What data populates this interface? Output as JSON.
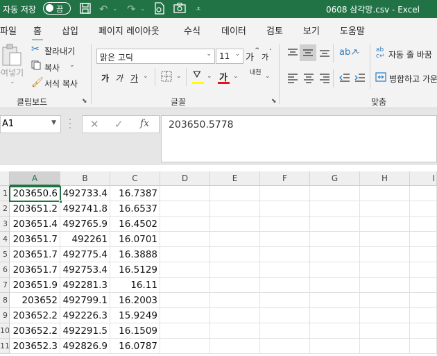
{
  "titlebar": {
    "autosave_label": "자동 저장",
    "toggle_label": "끔",
    "doc_title": "0608 삼각망.csv  -  Excel"
  },
  "tabs": [
    "파일",
    "홈",
    "삽입",
    "페이지 레이아웃",
    "수식",
    "데이터",
    "검토",
    "보기",
    "도움말"
  ],
  "active_tab": "홈",
  "clipboard": {
    "paste_label": "붙여넣기",
    "cut_label": "잘라내기",
    "copy_label": "복사",
    "format_painter_label": "서식 복사",
    "group_label": "클립보드"
  },
  "font": {
    "name": "맑은 고딕",
    "size": "11",
    "grow": "가",
    "shrink": "가",
    "bold": "가",
    "italic": "가",
    "underline": "가",
    "font_color": "가",
    "phonetic": "내천",
    "group_label": "글꼴",
    "fill_color": "#ffff00",
    "text_color": "#e81123"
  },
  "alignment": {
    "wrap_text_label": "자동 줄 바꿈",
    "merge_label": "병합하고 가운",
    "group_label": "맞춤"
  },
  "formula_bar": {
    "name_box": "A1",
    "cancel": "✕",
    "enter": "✓",
    "fx": "fx",
    "value": "203650.5778"
  },
  "accent_color": "#217346",
  "grid": {
    "columns": [
      "A",
      "B",
      "C",
      "D",
      "E",
      "F",
      "G",
      "H",
      "I"
    ],
    "row_headers": [
      "1",
      "2",
      "3",
      "4",
      "5",
      "6",
      "7",
      "8",
      "9",
      "10",
      "11"
    ],
    "rows": [
      [
        "203650.6",
        "492733.4",
        "16.7387"
      ],
      [
        "203651.2",
        "492741.8",
        "16.6537"
      ],
      [
        "203651.4",
        "492765.9",
        "16.4502"
      ],
      [
        "203651.7",
        "492261",
        "16.0701"
      ],
      [
        "203651.7",
        "492775.4",
        "16.3888"
      ],
      [
        "203651.7",
        "492753.4",
        "16.5129"
      ],
      [
        "203651.9",
        "492281.3",
        "16.11"
      ],
      [
        "203652",
        "492799.1",
        "16.2003"
      ],
      [
        "203652.2",
        "492226.3",
        "15.9249"
      ],
      [
        "203652.2",
        "492291.5",
        "16.1509"
      ],
      [
        "203652.3",
        "492826.9",
        "16.0787"
      ]
    ]
  }
}
